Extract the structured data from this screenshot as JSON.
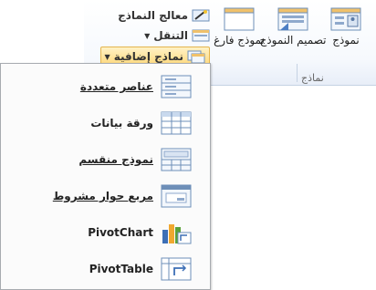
{
  "ribbon": {
    "buttons": {
      "form": "نموذج",
      "form_design": "تصميم النموذج",
      "blank_form": "نموذج فارغ"
    },
    "small": {
      "form_wizard": "معالج النماذج",
      "navigation": "التنقل",
      "more_forms": "نماذج إضافية"
    },
    "group_label": "نماذج"
  },
  "menu": {
    "items": [
      {
        "label": "عناصر متعددة"
      },
      {
        "label": "ورقة بيانات"
      },
      {
        "label": "نموذج منقسم"
      },
      {
        "label": "مربع حوار مشروط"
      },
      {
        "label": "PivotChart"
      },
      {
        "label": "PivotTable"
      }
    ]
  }
}
